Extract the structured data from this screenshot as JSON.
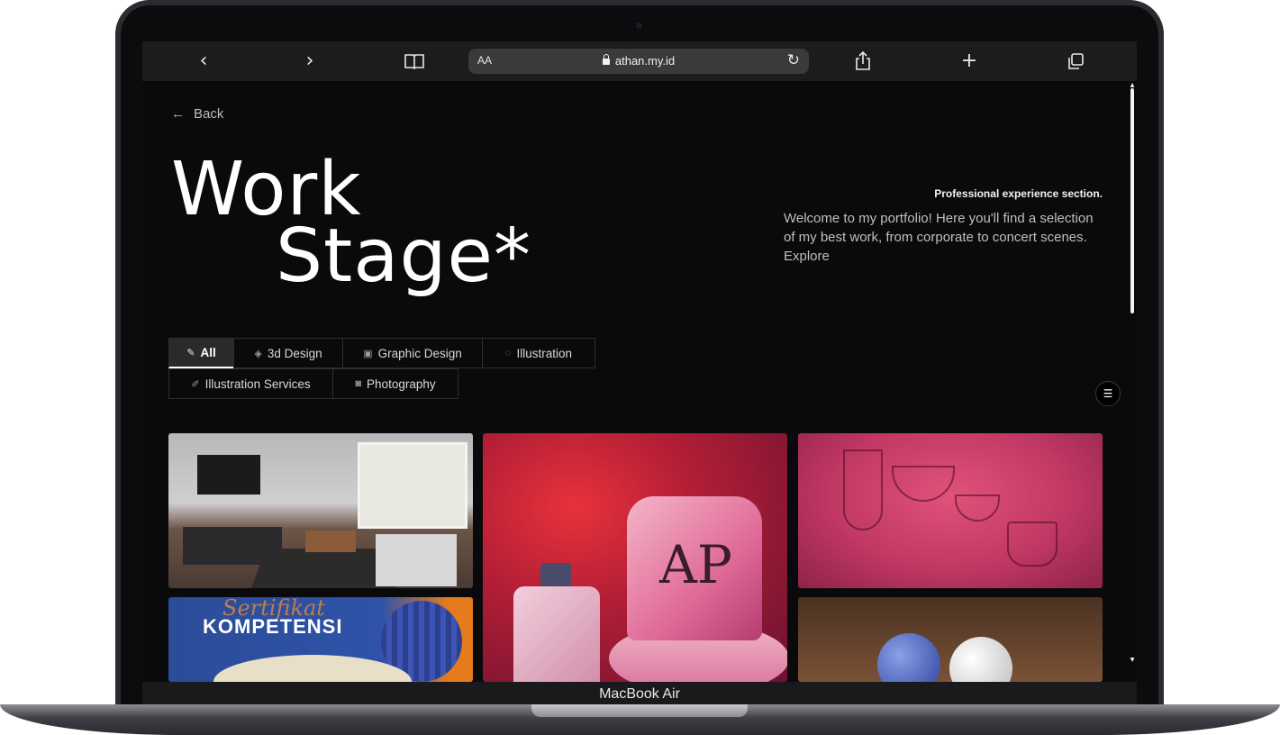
{
  "device": {
    "label": "MacBook Air"
  },
  "browser": {
    "back_icon": "‹",
    "forward_icon": "›",
    "text_size_label": "AA",
    "url": "athan.my.id",
    "reload_icon": "↻",
    "new_tab_icon": "+"
  },
  "page": {
    "back_label": "Back",
    "title_line1": "Work",
    "title_line2": "Stage*",
    "section_label": "Professional experience section.",
    "intro": "Welcome to my portfolio! Here you'll find a selection of my best work, from corporate to concert scenes. Explore"
  },
  "filters": [
    {
      "label": "All",
      "icon": "magic-wand-icon",
      "active": true
    },
    {
      "label": "3d Design",
      "icon": "cube-icon",
      "active": false
    },
    {
      "label": "Graphic Design",
      "icon": "image-icon",
      "active": false
    },
    {
      "label": "Illustration",
      "icon": "palette-icon",
      "active": false
    },
    {
      "label": "Illustration Services",
      "icon": "pen-icon",
      "active": false
    },
    {
      "label": "Photography",
      "icon": "camera-icon",
      "active": false
    }
  ],
  "gallery": {
    "cert_title": "KOMPETENSI",
    "cert_script": "Sertifikat",
    "perfume_logo": "AP"
  },
  "colors": {
    "background": "#0a0a0c",
    "accent": "#ffffff",
    "browser_bar": "#1c1c1e"
  }
}
